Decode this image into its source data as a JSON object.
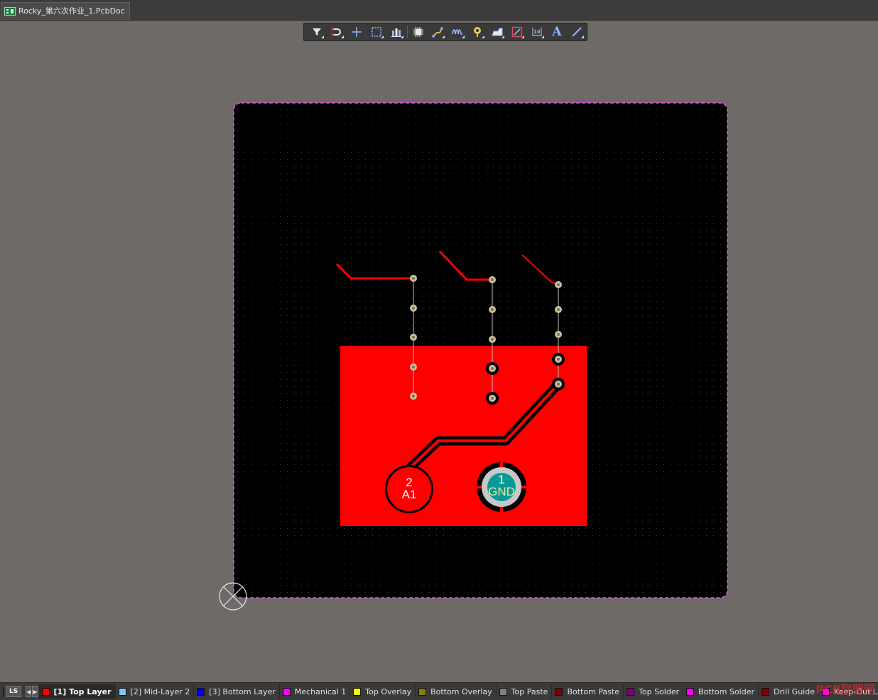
{
  "document_tab": {
    "title": "Rocky_第六次作业_1.PcbDoc",
    "icon": "pcb-doc-icon"
  },
  "toolbar": {
    "tools": [
      {
        "name": "filter-icon"
      },
      {
        "name": "interactive-route-icon"
      },
      {
        "name": "place-crosshair-icon"
      },
      {
        "name": "select-rectangle-icon"
      },
      {
        "name": "align-icon"
      },
      {
        "name": "place-component-icon"
      },
      {
        "name": "interactive-routing-icon"
      },
      {
        "name": "length-tuning-icon"
      },
      {
        "name": "place-via-icon"
      },
      {
        "name": "place-polygon-icon"
      },
      {
        "name": "place-region-icon"
      },
      {
        "name": "place-dimension-icon"
      },
      {
        "name": "place-string-icon"
      },
      {
        "name": "place-line-icon"
      }
    ],
    "string_tool_label": "A"
  },
  "board": {
    "pad2": {
      "number": "2",
      "net": "A1"
    },
    "pad1": {
      "number": "1",
      "net": "GND"
    }
  },
  "statusbar": {
    "current_layer_button": "LS",
    "layers": [
      {
        "label": "[1] Top Layer",
        "color": "#ff0000",
        "active": true
      },
      {
        "label": "[2] Mid-Layer 2",
        "color": "#7ec8f0",
        "active": false
      },
      {
        "label": "[3] Bottom Layer",
        "color": "#0000ff",
        "active": false
      },
      {
        "label": "Mechanical 1",
        "color": "#ff00ff",
        "active": false
      },
      {
        "label": "Top Overlay",
        "color": "#ffff00",
        "active": false
      },
      {
        "label": "Bottom Overlay",
        "color": "#808000",
        "active": false
      },
      {
        "label": "Top Paste",
        "color": "#808080",
        "active": false
      },
      {
        "label": "Bottom Paste",
        "color": "#800000",
        "active": false
      },
      {
        "label": "Top Solder",
        "color": "#800080",
        "active": false
      },
      {
        "label": "Bottom Solder",
        "color": "#ff00ff",
        "active": false
      },
      {
        "label": "Drill Guide",
        "color": "#800000",
        "active": false
      },
      {
        "label": "Keep-Out La",
        "color": "#ff00ff",
        "active": false
      }
    ]
  },
  "watermark": "PCB联盟网"
}
